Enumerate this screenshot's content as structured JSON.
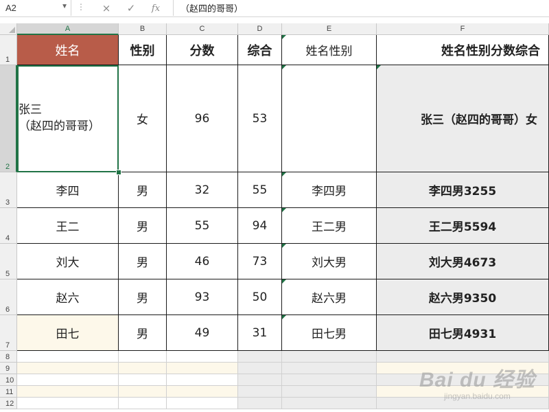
{
  "formula_bar": {
    "name_box": "A2",
    "cancel_icon": "×",
    "enter_icon": "✓",
    "fx_icon": "fx",
    "content": "（赵四的哥哥）"
  },
  "columns": [
    "A",
    "B",
    "C",
    "D",
    "E",
    "F"
  ],
  "rows": [
    "1",
    "2",
    "3",
    "4",
    "5",
    "6",
    "7",
    "8",
    "9",
    "10",
    "11",
    "12"
  ],
  "table": {
    "headers": [
      "姓名",
      "性别",
      "分数",
      "综合",
      "姓名性别",
      "姓名性别分数综合"
    ],
    "data": [
      [
        "张三\n（赵四的哥哥）",
        "女",
        "96",
        "53",
        "",
        "张三（赵四的哥哥）女"
      ],
      [
        "李四",
        "男",
        "32",
        "55",
        "李四男",
        "李四男3255"
      ],
      [
        "王二",
        "男",
        "55",
        "94",
        "王二男",
        "王二男5594"
      ],
      [
        "刘大",
        "男",
        "46",
        "73",
        "刘大男",
        "刘大男4673"
      ],
      [
        "赵六",
        "男",
        "93",
        "50",
        "赵六男",
        "赵六男9350"
      ],
      [
        "田七",
        "男",
        "49",
        "31",
        "田七男",
        "田七男4931"
      ]
    ]
  },
  "watermark": {
    "logo": "Bai du 经验",
    "sub": "jingyan.baidu.com"
  },
  "colors": {
    "header_fill": "#b85c49",
    "selection": "#217346",
    "row_fill": "#fdf8ea",
    "gray_fill": "#ececec"
  }
}
